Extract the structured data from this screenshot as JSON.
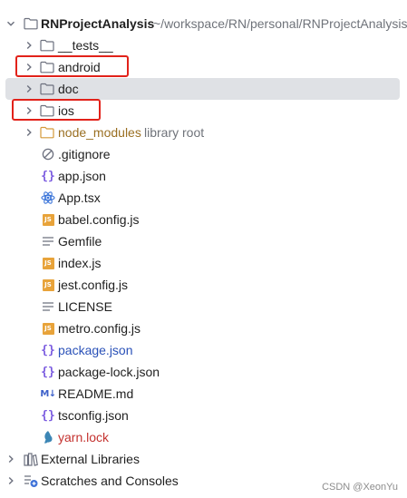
{
  "project": {
    "name": "RNProjectAnalysis",
    "path": "~/workspace/RN/personal/RNProjectAnalysis"
  },
  "folders": {
    "tests": "__tests__",
    "android": "android",
    "doc": "doc",
    "ios": "ios",
    "node_modules": "node_modules",
    "node_modules_hint": "library root"
  },
  "files": {
    "gitignore": ".gitignore",
    "app_json": "app.json",
    "app_tsx": "App.tsx",
    "babel": "babel.config.js",
    "gemfile": "Gemfile",
    "index": "index.js",
    "jest": "jest.config.js",
    "license": "LICENSE",
    "metro": "metro.config.js",
    "package_json": "package.json",
    "package_lock": "package-lock.json",
    "readme": "README.md",
    "tsconfig": "tsconfig.json",
    "yarn": "yarn.lock"
  },
  "bottom": {
    "external_libraries": "External Libraries",
    "scratches": "Scratches and Consoles"
  },
  "icons": {
    "md_badge": "M↓"
  },
  "watermark": "CSDN @XeonYu",
  "colors": {
    "selection": "#dfe1e5",
    "highlight_box": "#e2221a",
    "folder_excluded": "#9a6f22",
    "modified_blue": "#2a51b8",
    "ignored_red": "#c4322f"
  }
}
